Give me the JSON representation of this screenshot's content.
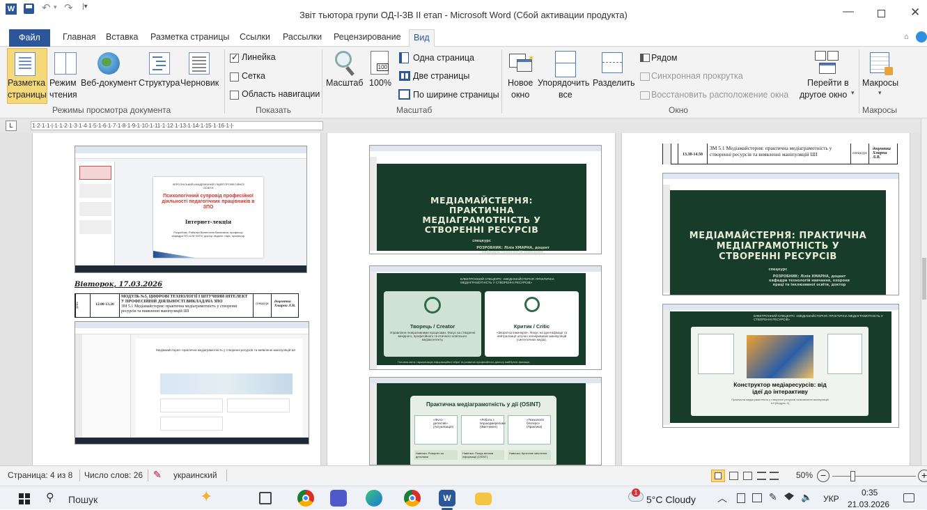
{
  "window": {
    "title": "Звіт тьютора групи ОД-І-3В  ІІ етап  -  Microsoft Word (Сбой активации продукта)"
  },
  "tabs": [
    {
      "label": "Файл"
    },
    {
      "label": "Главная"
    },
    {
      "label": "Вставка"
    },
    {
      "label": "Разметка страницы"
    },
    {
      "label": "Ссылки"
    },
    {
      "label": "Рассылки"
    },
    {
      "label": "Рецензирование"
    },
    {
      "label": "Вид"
    }
  ],
  "ribbon": {
    "views": {
      "print_layout_1": "Разметка",
      "print_layout_2": "страницы",
      "reading_1": "Режим",
      "reading_2": "чтения",
      "web": "Веб-документ",
      "outline": "Структура",
      "draft": "Черновик",
      "group": "Режимы просмотра документа"
    },
    "show": {
      "ruler": "Линейка",
      "grid": "Сетка",
      "nav": "Область навигации",
      "group": "Показать"
    },
    "zoom": {
      "zoom": "Масштаб",
      "percent": "100%",
      "one_page": "Одна страница",
      "two_pages": "Две страницы",
      "page_width": "По ширине страницы",
      "group": "Масштаб"
    },
    "window": {
      "new_1": "Новое",
      "new_2": "окно",
      "arrange_1": "Упорядочить",
      "arrange_2": "все",
      "split": "Разделить",
      "side": "Рядом",
      "sync": "Синхронная прокрутка",
      "reset": "Восстановить расположение окна",
      "switch_1": "Перейти в",
      "switch_2": "другое окно",
      "group": "Окно"
    },
    "macros": {
      "label": "Макросы",
      "group": "Макросы"
    }
  },
  "ruler": {
    "marks": "1·2·1·1·|·1·1·2·1·3·1·4·1·5·1·6·1·7·1·8·1·9·1·10·1·11·1·12·1·13·1·14·1·15·1·16·1·|·"
  },
  "doc": {
    "p1": {
      "slide_org": "ХЕРСОНСЬКИЙ АКАДЕМІЧНИЙ ЛІЦЕЙ ПРОФЕСІЙНОЇ ОСВІТИ",
      "slide_title": "Психологічний супровід професійної діяльності педагогічних працівників в ЗПО",
      "slide_sub": "Інтернет-лекція",
      "slide_author": "Розробник: Рибалка Валентина Василівна, професор кафедри ПП та М ХНПУ, доктор педагог. наук, професор",
      "date": "Вівторок, 17.03.2026",
      "schedule_day": "день",
      "schedule_time": "12.00-13.20",
      "schedule_module": "МОДУЛЬ №5. ЦИФРОВІ ТЕХНОЛОГІЇ І ШТУЧНИЙ ІНТЕЛЕКТ У ПРОФЕСІЙНІЙ ДІЯЛЬНОСТІ ВИКЛАДАЧА ЗПО",
      "schedule_topic": "ЗМ 5.1 Медіамайстерня: практична медіаграмотність у створенні ресурсів та виявленні маніпуляцій ШІ",
      "schedule_type": "спецкурс",
      "schedule_teacher": "доцентка Хмарна Л.В.",
      "teams_title": "Медіамайстерня: практична медіаграмотність у створенні ресурсів та виявленні маніпуляцій ШІ"
    },
    "p2": {
      "slide1_title": "МЕДІАМАЙСТЕРНЯ: ПРАКТИЧНА МЕДІАГРАМОТНІСТЬ У СТВОРЕННІ РЕСУРСІВ",
      "slide1_tag": "спецкурс",
      "slide1_author": "РОЗРОБНИК: Лілія ХМАРНА, доцент кафедри технологій навчання, охорони праці та інклюзивної освіти, доктор",
      "slide2_header": "ЕЛЕКТРОННИЙ СПЕЦКУРС «МЕДІАМАЙСТЕРНЯ: ПРАКТИЧНА МЕДІАГРАМОТНІСТЬ У СТВОРЕННІ РЕСУРСІВ»",
      "creator_title": "Творець / Creator",
      "creator_text": "Управління генеративними процесами. Фокус на створенні вихідного, професійного та етичного освітнього медіаконтенту.",
      "critic_title": "Критик / Critic",
      "critic_text": "«Зворотна інженерія». Фокус на ідентифікації та нейтралізації штучно згенерованих маніпуляцій (синтетичних медіа).",
      "slide2_footer": "Головна мета: гармонізація інформаційної зброї та розвиток професійного діалогу майбутніх фахівців",
      "slide3_title": "Практична медіаграмотність у дії (OSINT)",
      "card1": "«Фото-детектив» (Актуалізація)",
      "card2": "«Робота з першоджерелом» (Фактчекінг)",
      "card3": "«Технологія блогеро» (Практика)",
      "bottom1": "Навичка: Розкрити за деталями",
      "bottom2": "Навичка: Пошук витоків інформації (OSINT)",
      "bottom3": "Навичка: Критичне мислення"
    },
    "p3": {
      "schedule_time": "13.30-14.50",
      "schedule_topic": "ЗМ 5.1 Медіамайстерня: практична медіаграмотність у створенні ресурсів та виявленні маніпуляцій ШІ",
      "schedule_type": "спецкурс",
      "schedule_teacher": "доцентка Хмарна Л.В.",
      "slide1_title": "МЕДІАМАЙСТЕРНЯ: ПРАКТИЧНА МЕДІАГРАМОТНІСТЬ У СТВОРЕННІ РЕСУРСІВ",
      "slide1_tag": "спецкурс",
      "slide1_author": "РОЗРОБНИК: Лілія ХМАРНА, доцент кафедри технологій навчання, охорони праці та інклюзивної освіти, доктор",
      "slide2_header": "ЕЛЕКТРОННИЙ СПЕЦКУРС «МЕДІАМАЙСТЕРНЯ: ПРАКТИЧНА МЕДІАГРАМОТНІСТЬ У СТВОРЕННІ РЕСУРСІВ»",
      "slide2_title": "Конструктор медіаресурсів: від ідеї до інтерактиву",
      "slide2_sub": "Практична медіаграмотність у створенні ресурсів та виявленні маніпуляцій ШІ (Модуль 2)"
    }
  },
  "status": {
    "page": "Страница: 4 из 8",
    "words": "Число слов: 26",
    "lang": "украинский",
    "zoom": "50%"
  },
  "taskbar": {
    "search": "Пошук",
    "weather": "5°C  Cloudy",
    "lang": "УКР",
    "time": "0:35",
    "date": "21.03.2026",
    "badge": "1"
  },
  "colors": {
    "word_blue": "#2b579a",
    "slide_green": "#173d2a",
    "active_view": "#f5d87a"
  }
}
